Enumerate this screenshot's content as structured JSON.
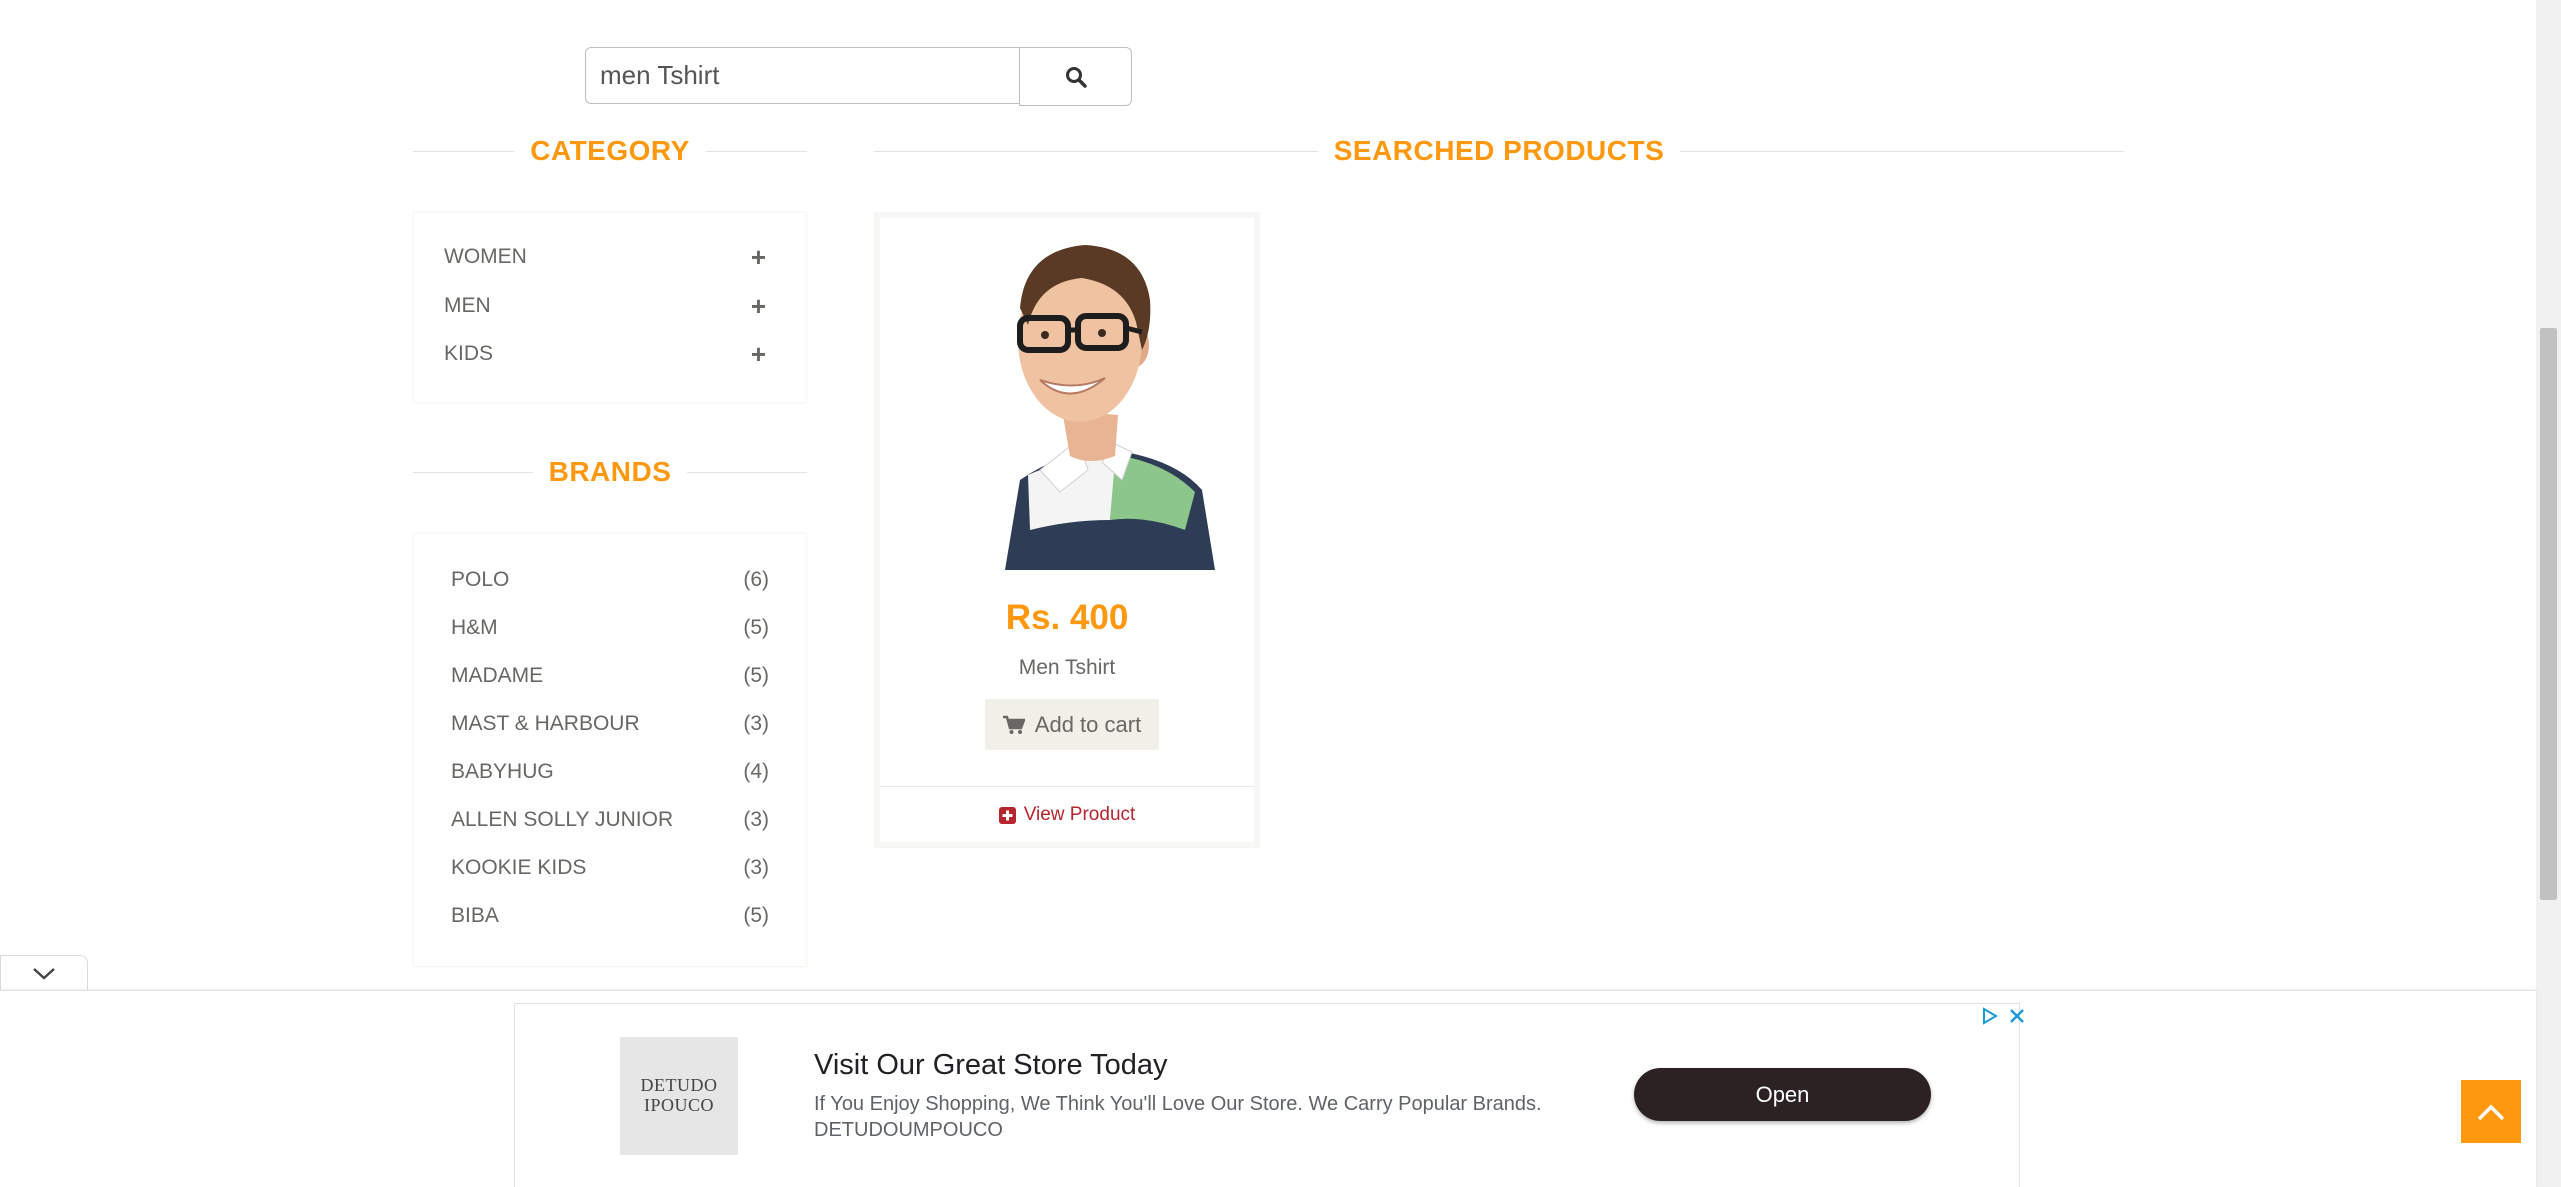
{
  "search": {
    "value": "men Tshirt",
    "icon": "search-icon"
  },
  "category": {
    "title": "CATEGORY",
    "items": [
      {
        "label": "WOMEN",
        "icon": "plus-icon"
      },
      {
        "label": "MEN",
        "icon": "plus-icon"
      },
      {
        "label": "KIDS",
        "icon": "plus-icon"
      }
    ]
  },
  "brands": {
    "title": "BRANDS",
    "items": [
      {
        "name": "POLO",
        "count": "(6)"
      },
      {
        "name": "H&M",
        "count": "(5)"
      },
      {
        "name": "MADAME",
        "count": "(5)"
      },
      {
        "name": "MAST & HARBOUR",
        "count": "(3)"
      },
      {
        "name": "BABYHUG",
        "count": "(4)"
      },
      {
        "name": "ALLEN SOLLY JUNIOR",
        "count": "(3)"
      },
      {
        "name": "KOOKIE KIDS",
        "count": "(3)"
      },
      {
        "name": "BIBA",
        "count": "(5)"
      }
    ]
  },
  "products": {
    "title": "SEARCHED PRODUCTS",
    "items": [
      {
        "price": "Rs. 400",
        "name": "Men Tshirt",
        "add_to_cart": "Add to cart",
        "view_product": "View Product"
      }
    ]
  },
  "ad": {
    "logo_line1": "DETUDO",
    "logo_line2": "IPOUCO",
    "headline": "Visit Our Great Store Today",
    "description": "If You Enjoy Shopping, We Think You'll Love Our Store. We Carry Popular Brands.",
    "advertiser": "DETUDOUMPOUCO",
    "cta": "Open"
  },
  "colors": {
    "accent": "#fe980f",
    "link": "#b4252e",
    "text": "#696763"
  }
}
